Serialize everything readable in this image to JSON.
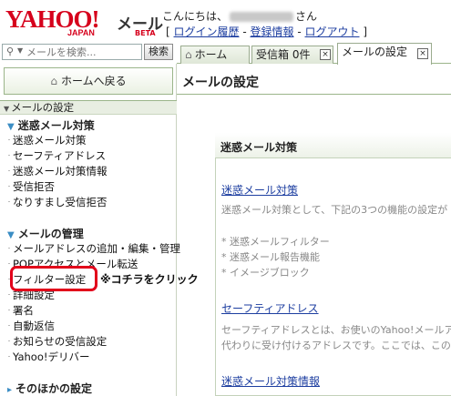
{
  "header": {
    "logo_text": "YAHOO!",
    "logo_sub": "JAPAN",
    "mail_title": "メール",
    "beta": "BETA",
    "greeting_prefix": "こんにちは、",
    "greeting_suffix": "さん",
    "bracket_open": "[",
    "login_history": "ログイン履歴",
    "sep1": " - ",
    "registration": "登録情報",
    "sep2": " - ",
    "logout": "ログアウト",
    "bracket_close": "]"
  },
  "search": {
    "placeholder": "メールを検索...",
    "button": "検索"
  },
  "tabs": [
    {
      "label": "ホーム",
      "icon": "home-icon"
    },
    {
      "label": "受信箱 0件",
      "close": "×"
    },
    {
      "label": "メールの設定",
      "close": "×"
    }
  ],
  "sidebar": {
    "home_button": "ホームへ戻る",
    "section_header": "メールの設定",
    "spam": {
      "title": "迷惑メール対策",
      "items": [
        "迷惑メール対策",
        "セーフティアドレス",
        "迷惑メール対策情報",
        "受信拒否",
        "なりすまし受信拒否"
      ]
    },
    "manage": {
      "title": "メールの管理",
      "items": [
        "メールアドレスの追加・編集・管理",
        "POPアクセスとメール転送",
        "フィルター設定",
        "詳細設定",
        "署名",
        "自動返信",
        "お知らせの受信設定",
        "Yahoo!デリバー"
      ]
    },
    "other": {
      "title": "そのほかの設定"
    }
  },
  "annotation": "※コチラをクリック",
  "main": {
    "title": "メールの設定",
    "panel_title": "迷惑メール対策",
    "spam_link": "迷惑メール対策",
    "spam_desc": "迷惑メール対策として、下記の3つの機能の設定が",
    "bullets": [
      "* 迷惑メールフィルター",
      "* 迷惑メール報告機能",
      "* イメージブロック"
    ],
    "safety_link": "セーフティアドレス",
    "safety_desc1": "セーフティアドレスとは、お使いのYahoo!メールア",
    "safety_desc2": "代わりに受け付けるアドレスです。ここでは、この名",
    "spam_info_link": "迷惑メール対策情報"
  },
  "colors": {
    "brand_red": "#d6001c",
    "link_blue": "#1d3ea0",
    "highlight_red": "#e2001a",
    "border_green": "#9bb58a"
  }
}
